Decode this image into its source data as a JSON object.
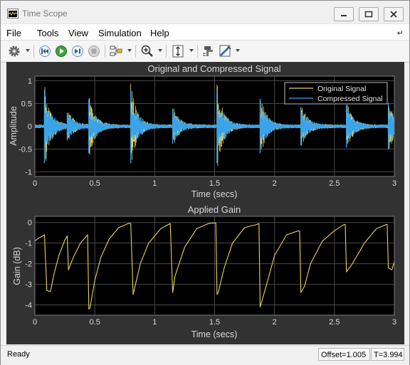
{
  "window": {
    "title": "Time Scope",
    "controls": [
      "minimize-icon",
      "restore-icon",
      "close-icon"
    ]
  },
  "menu": {
    "items": [
      "File",
      "Tools",
      "View",
      "Simulation",
      "Help"
    ],
    "pin_glyph": "↵"
  },
  "toolbar": {
    "icons": [
      "gear-icon",
      "rewind-icon",
      "run-icon",
      "step-forward-icon",
      "stop-icon",
      "signal-select-icon",
      "zoom-in-icon",
      "scale-axes-icon",
      "highlight-icon",
      "style-icon"
    ]
  },
  "colors": {
    "original": "#e5d35c",
    "compressed": "#3aa3ea",
    "axes_bg": "#000000",
    "figure_bg": "#323232",
    "grid": "#4a4a4a"
  },
  "chart_data": [
    {
      "type": "line",
      "title": "Original and Compressed Signal",
      "xlabel": "Time (secs)",
      "ylabel": "Amplitude",
      "xlim": [
        0,
        3
      ],
      "ylim": [
        -1.1,
        1.1
      ],
      "xticks": [
        "0",
        "0.5",
        "1",
        "1.5",
        "2",
        "2.5",
        "3"
      ],
      "yticks": [
        "1",
        "0.5",
        "0",
        "-0.5",
        "-1"
      ],
      "grid": true,
      "legend_position": "top-right",
      "series": [
        {
          "name": "Original Signal"
        },
        {
          "name": "Compressed Signal"
        }
      ],
      "transients": [
        {
          "t": 0.08,
          "amp": 0.95
        },
        {
          "t": 0.27,
          "amp": 0.35
        },
        {
          "t": 0.45,
          "amp": 0.7
        },
        {
          "t": 0.8,
          "amp": 0.95
        },
        {
          "t": 1.15,
          "amp": 0.45
        },
        {
          "t": 1.52,
          "amp": 0.95
        },
        {
          "t": 1.88,
          "amp": 0.7
        },
        {
          "t": 2.22,
          "amp": 0.5
        },
        {
          "t": 2.6,
          "amp": 0.55
        },
        {
          "t": 2.95,
          "amp": 0.6
        }
      ]
    },
    {
      "type": "line",
      "title": "Applied Gain",
      "xlabel": "Time (secs)",
      "ylabel": "Gain (dB)",
      "xlim": [
        0,
        3
      ],
      "ylim": [
        -4.5,
        0.3
      ],
      "xticks": [
        "0",
        "0.5",
        "1",
        "1.5",
        "2",
        "2.5",
        "3"
      ],
      "yticks": [
        "0",
        "-1",
        "-2",
        "-3",
        "-4"
      ],
      "grid": true,
      "series": [
        {
          "name": "Applied Gain",
          "x": [
            0,
            0.02,
            0.08,
            0.1,
            0.13,
            0.16,
            0.2,
            0.25,
            0.27,
            0.28,
            0.32,
            0.38,
            0.44,
            0.45,
            0.46,
            0.5,
            0.55,
            0.62,
            0.7,
            0.78,
            0.8,
            0.82,
            0.88,
            0.95,
            1.05,
            1.13,
            1.15,
            1.17,
            1.25,
            1.35,
            1.45,
            1.51,
            1.52,
            1.53,
            1.58,
            1.65,
            1.75,
            1.85,
            1.87,
            1.88,
            1.92,
            2.0,
            2.1,
            2.2,
            2.21,
            2.22,
            2.25,
            2.3,
            2.4,
            2.5,
            2.58,
            2.59,
            2.6,
            2.65,
            2.75,
            2.85,
            2.93,
            2.94,
            2.95,
            2.98,
            3.0
          ],
          "values": [
            -0.9,
            -0.8,
            -0.6,
            -3.3,
            -3.35,
            -2.5,
            -1.6,
            -0.85,
            -0.65,
            -2.3,
            -1.7,
            -1.0,
            -0.6,
            -4.2,
            -4.15,
            -2.8,
            -1.7,
            -0.8,
            -0.25,
            -0.05,
            -0.05,
            -3.5,
            -2.0,
            -1.0,
            -0.3,
            -0.05,
            -3.4,
            -2.6,
            -1.2,
            -0.3,
            -0.05,
            -0.02,
            -3.5,
            -3.4,
            -2.2,
            -1.0,
            -0.25,
            -0.1,
            -0.05,
            -4.1,
            -3.3,
            -1.6,
            -0.6,
            -0.4,
            -0.45,
            -3.4,
            -3.1,
            -2.0,
            -0.9,
            -0.4,
            -0.1,
            -0.1,
            -2.4,
            -2.0,
            -1.0,
            -0.3,
            -0.1,
            -0.1,
            -2.2,
            -2.3,
            -1.9
          ]
        }
      ]
    }
  ],
  "status": {
    "text": "Ready",
    "offset": "Offset=1.005",
    "time": "T=3.994"
  }
}
